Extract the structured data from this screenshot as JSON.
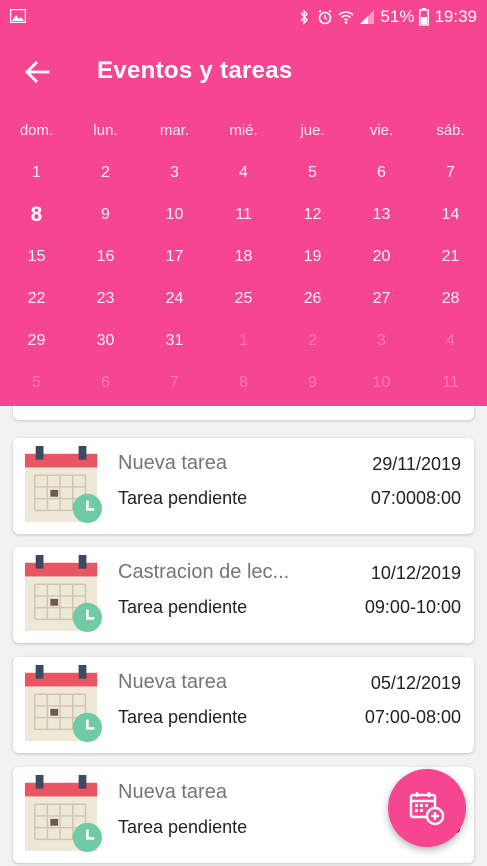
{
  "status_bar": {
    "battery_percent": "51%",
    "time": "19:39"
  },
  "toolbar": {
    "title": "Eventos y tareas"
  },
  "calendar": {
    "weekdays": [
      "dom.",
      "lun.",
      "mar.",
      "mié.",
      "jue.",
      "vie.",
      "sáb."
    ],
    "today": "8",
    "weeks": [
      [
        {
          "d": "1",
          "dim": false
        },
        {
          "d": "2",
          "dim": false
        },
        {
          "d": "3",
          "dim": false
        },
        {
          "d": "4",
          "dim": false
        },
        {
          "d": "5",
          "dim": false
        },
        {
          "d": "6",
          "dim": false
        },
        {
          "d": "7",
          "dim": false
        }
      ],
      [
        {
          "d": "8",
          "dim": false
        },
        {
          "d": "9",
          "dim": false
        },
        {
          "d": "10",
          "dim": false
        },
        {
          "d": "11",
          "dim": false
        },
        {
          "d": "12",
          "dim": false
        },
        {
          "d": "13",
          "dim": false
        },
        {
          "d": "14",
          "dim": false
        }
      ],
      [
        {
          "d": "15",
          "dim": false
        },
        {
          "d": "16",
          "dim": false
        },
        {
          "d": "17",
          "dim": false
        },
        {
          "d": "18",
          "dim": false
        },
        {
          "d": "19",
          "dim": false
        },
        {
          "d": "20",
          "dim": false
        },
        {
          "d": "21",
          "dim": false
        }
      ],
      [
        {
          "d": "22",
          "dim": false
        },
        {
          "d": "23",
          "dim": false
        },
        {
          "d": "24",
          "dim": false
        },
        {
          "d": "25",
          "dim": false
        },
        {
          "d": "26",
          "dim": false
        },
        {
          "d": "27",
          "dim": false
        },
        {
          "d": "28",
          "dim": false
        }
      ],
      [
        {
          "d": "29",
          "dim": false
        },
        {
          "d": "30",
          "dim": false
        },
        {
          "d": "31",
          "dim": false
        },
        {
          "d": "1",
          "dim": true
        },
        {
          "d": "2",
          "dim": true
        },
        {
          "d": "3",
          "dim": true
        },
        {
          "d": "4",
          "dim": true
        }
      ],
      [
        {
          "d": "5",
          "dim": true
        },
        {
          "d": "6",
          "dim": true
        },
        {
          "d": "7",
          "dim": true
        },
        {
          "d": "8",
          "dim": true
        },
        {
          "d": "9",
          "dim": true
        },
        {
          "d": "10",
          "dim": true
        },
        {
          "d": "11",
          "dim": true
        }
      ]
    ]
  },
  "tasks": [
    {
      "name": "Nueva tarea",
      "status": "Tarea pendiente",
      "date": "29/11/2019",
      "time": "07:0008:00"
    },
    {
      "name": "Castracion de lec...",
      "status": "Tarea pendiente",
      "date": "10/12/2019",
      "time": "09:00-10:00"
    },
    {
      "name": "Nueva tarea",
      "status": "Tarea pendiente",
      "date": "05/12/2019",
      "time": "07:00-08:00"
    },
    {
      "name": "Nueva tarea",
      "status": "Tarea pendiente",
      "date": "05/1",
      "time": "07:00"
    }
  ],
  "colors": {
    "accent": "#f64591",
    "clock_badge": "#6ecba6",
    "calendar_header": "#e95562"
  },
  "icons": {
    "back": "arrow-left-icon",
    "fab": "calendar-add-icon",
    "task": "calendar-clock-icon"
  }
}
